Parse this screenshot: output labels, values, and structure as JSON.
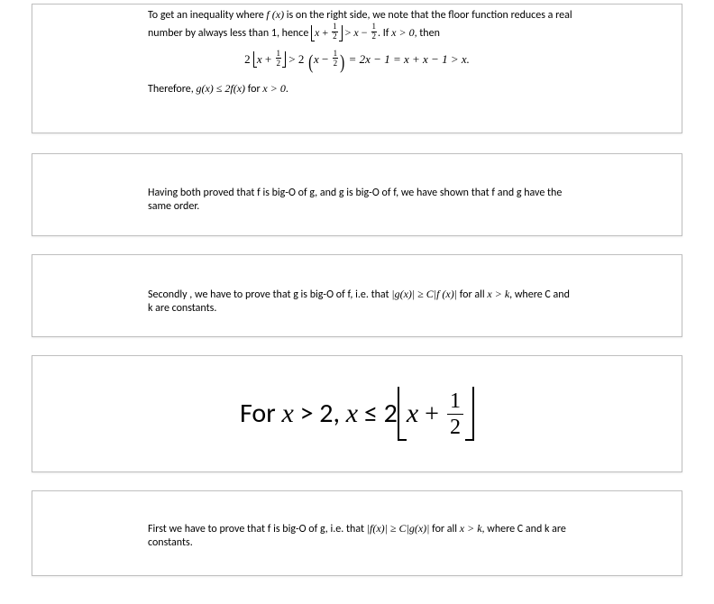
{
  "card1": {
    "p1a": "To get an inequality where ",
    "p1b": " is on the right side, we note that the floor function reduces a real number by always less than 1, hence ",
    "p1c": ". If ",
    "p1d": ", then",
    "thereforeA": "Therefore, ",
    "thereforeB": " for "
  },
  "card2": {
    "text": "Having both proved that f is big-O of g, and g is big-O of f, we have shown that f and g have the same order."
  },
  "card3": {
    "textA": "Secondly , we have to prove that g is big-O of f, i.e. that ",
    "textB": " for all ",
    "textC": ", where C and k are constants."
  },
  "card4": {
    "leadA": "For ",
    "leadB": " > 2, ",
    "leadC": " ≤ 2"
  },
  "card5": {
    "textA": "First we have to prove that f is big-O of g, i.e. that ",
    "textB": " for all ",
    "textC": ", where C and k are constants."
  },
  "sym": {
    "fx": "f (x)",
    "gx": "g(x)",
    "x": "x",
    "k": "k",
    "gt0": "x > 0",
    "xgtk": "x > k",
    "half_n": "1",
    "half_d": "2",
    "gt": " > ",
    "ge": " ≥ ",
    "le": " ≤ ",
    "minus": " − ",
    "plus": " + ",
    "eq": " = ",
    "two": "2",
    "one": "1",
    "dot": ".",
    "eqchain": " = 2x − 1 = x + x − 1 > x.",
    "abs_g": "|g(x)|",
    "abs_fx": "|f(x)|",
    "Cabs_f": "C|f (x)|",
    "Cabs_g": "C|g(x)|",
    "g_le_2f": "g(x) ≤ 2f(x)"
  }
}
